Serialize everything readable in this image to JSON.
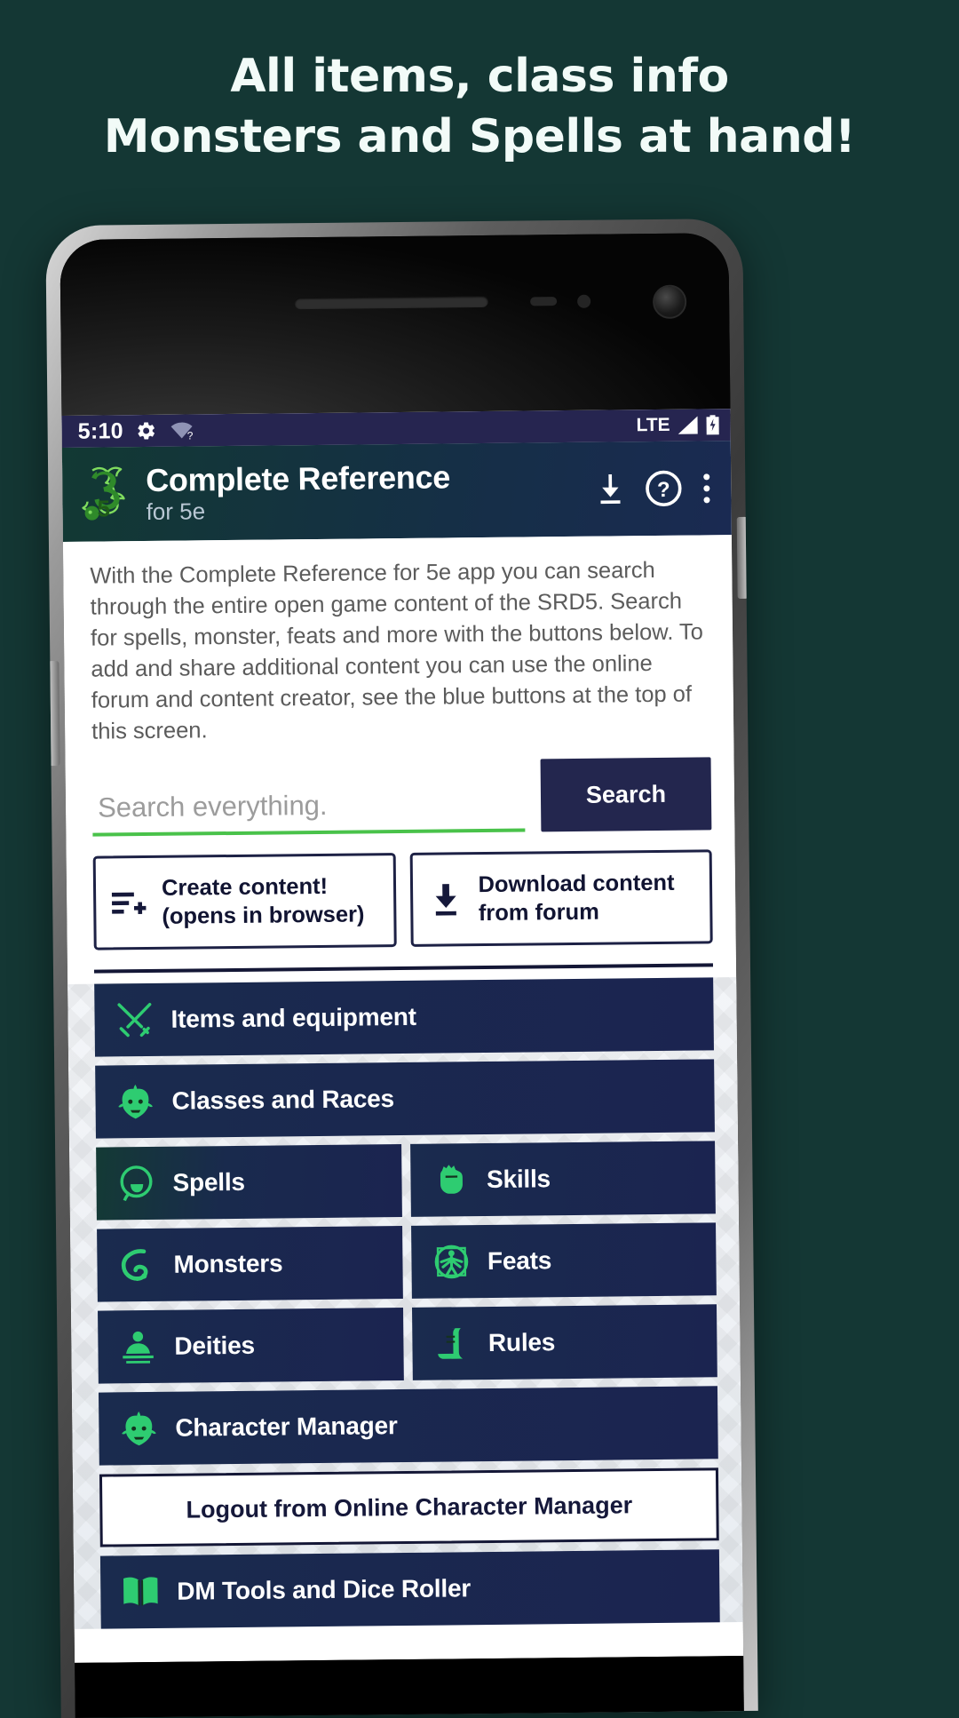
{
  "promo": {
    "line1": "All items, class info",
    "line2": "Monsters and Spells at hand!",
    "bg_color": "#143734",
    "text_color": "#f2fbf8"
  },
  "status_bar": {
    "time": "5:10",
    "gear_icon": "gear-icon",
    "wifi_question_icon": "wifi-question-icon",
    "network": "LTE",
    "signal_icon": "signal-bars-icon",
    "battery_icon": "battery-charging-icon",
    "bg_color": "#262550"
  },
  "app_bar": {
    "logo_icon": "dragon-5e-logo-icon",
    "title": "Complete Reference",
    "subtitle": "for 5e",
    "actions": [
      {
        "name": "download-button",
        "icon": "download-icon"
      },
      {
        "name": "help-button",
        "icon": "help-circle-icon"
      },
      {
        "name": "overflow-menu-button",
        "icon": "more-vertical-icon"
      }
    ],
    "accent_color": "#1a2a52"
  },
  "description": "With the Complete Reference for 5e app you can search through the entire open game content of the SRD5. Search for spells, monster, feats and more with the buttons below. To add and share additional content you can use the online forum and content creator, see the blue buttons at the top of this screen.",
  "search": {
    "placeholder": "Search everything.",
    "value": "",
    "underline_color": "#49c24a",
    "button_label": "Search",
    "button_color": "#23264e"
  },
  "action_buttons": [
    {
      "name": "create-content-button",
      "icon": "list-plus-icon",
      "line1": "Create content!",
      "line2": "(opens in browser)"
    },
    {
      "name": "download-content-button",
      "icon": "download-tray-icon",
      "line1": "Download content",
      "line2": "from forum"
    }
  ],
  "menu": {
    "rows": [
      [
        {
          "label": "Items and equipment",
          "icon": "crossed-swords-icon",
          "name": "menu-items-and-equipment"
        }
      ],
      [
        {
          "label": "Classes and Races",
          "icon": "orc-head-icon",
          "name": "menu-classes-and-races"
        }
      ],
      [
        {
          "label": "Spells",
          "icon": "magic-hand-icon",
          "name": "menu-spells"
        },
        {
          "label": "Skills",
          "icon": "fist-icon",
          "name": "menu-skills"
        }
      ],
      [
        {
          "label": "Monsters",
          "icon": "tentacle-icon",
          "name": "menu-monsters"
        },
        {
          "label": "Feats",
          "icon": "vitruvian-man-icon",
          "name": "menu-feats"
        }
      ],
      [
        {
          "label": "Deities",
          "icon": "deity-icon",
          "name": "menu-deities"
        },
        {
          "label": "Rules",
          "icon": "scroll-icon",
          "name": "menu-rules"
        }
      ],
      [
        {
          "label": "Character Manager",
          "icon": "orc-head-icon",
          "name": "menu-character-manager"
        }
      ]
    ],
    "logout_label": "Logout from Online Character Manager",
    "dm_tools": {
      "label": "DM Tools and Dice Roller",
      "icon": "open-book-icon",
      "name": "menu-dm-tools"
    },
    "tile_color": "#1b2450",
    "icon_color": "#2ecc71"
  }
}
